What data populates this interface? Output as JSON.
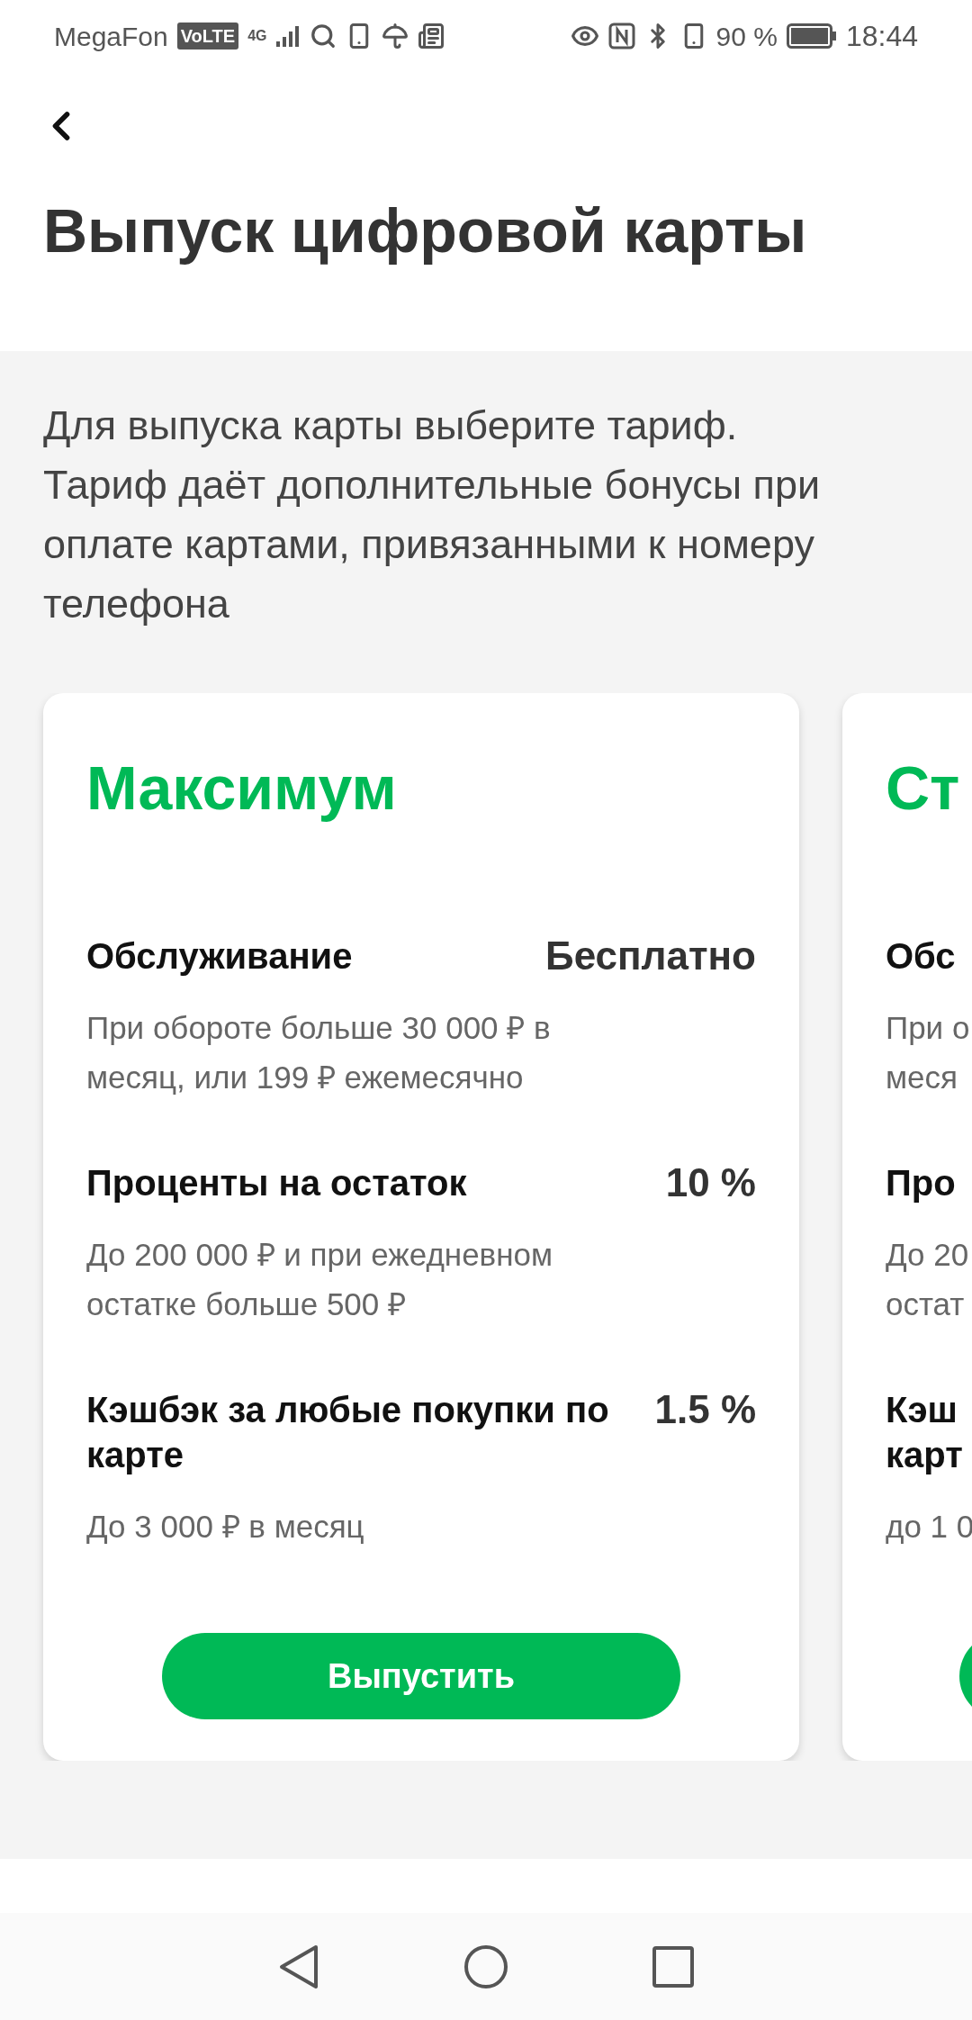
{
  "status_bar": {
    "carrier": "MegaFon",
    "volte": "VoLTE",
    "network": "4G",
    "battery": "90 %",
    "time": "18:44"
  },
  "header": {
    "title": "Выпуск цифровой карты"
  },
  "intro": [
    "Для выпуска карты выберите тариф.",
    "Тариф даёт дополнительные бонусы при",
    "оплате картами, привязанными к номеру",
    "телефона"
  ],
  "cards": [
    {
      "title": "Максимум",
      "rows": [
        {
          "label": [
            "Обслуживание"
          ],
          "value": "Бесплатно",
          "note": [
            "При обороте больше 30 000 ₽ в",
            "месяц, или 199 ₽ ежемесячно"
          ]
        },
        {
          "label": [
            "Проценты на остаток"
          ],
          "value": "10 %",
          "note": [
            "До 200 000 ₽ и при ежедневном",
            "остатке больше 500 ₽"
          ]
        },
        {
          "label": [
            "Кэшбэк за любые покупки по",
            "карте"
          ],
          "value": "1.5 %",
          "note": [
            "До 3 000 ₽ в месяц"
          ]
        }
      ],
      "button": "Выпустить"
    },
    {
      "title": "Ст",
      "rows": [
        {
          "label": [
            "Обс"
          ],
          "note": [
            "При о",
            "меся"
          ]
        },
        {
          "label": [
            "Про"
          ],
          "note": [
            "До 20",
            "остат"
          ]
        },
        {
          "label": [
            "Кэш",
            "карт"
          ],
          "note": [
            "до 1 0"
          ]
        }
      ]
    }
  ]
}
